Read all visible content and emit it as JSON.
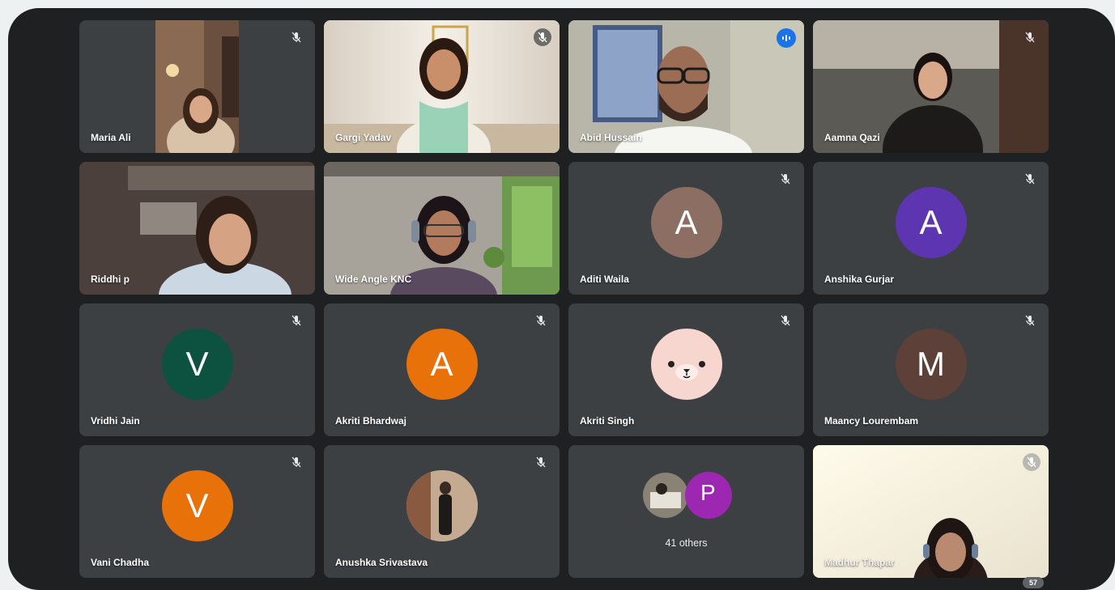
{
  "meeting": {
    "participants_count": "57",
    "others_label": "41 others",
    "tiles": [
      {
        "name": "Maria Ali"
      },
      {
        "name": "Gargi Yadav"
      },
      {
        "name": "Abid Hussain"
      },
      {
        "name": "Aamna Qazi"
      },
      {
        "name": "Riddhi p"
      },
      {
        "name": "Wide Angle KNC"
      },
      {
        "name": "Aditi Waila",
        "initial": "A"
      },
      {
        "name": "Anshika Gurjar",
        "initial": "A"
      },
      {
        "name": "Vridhi Jain",
        "initial": "V"
      },
      {
        "name": "Akriti Bhardwaj",
        "initial": "A"
      },
      {
        "name": "Akriti Singh"
      },
      {
        "name": "Maancy Lourembam",
        "initial": "M"
      },
      {
        "name": "Vani Chadha",
        "initial": "V"
      },
      {
        "name": "Anushka Srivastava"
      },
      {
        "name": ""
      },
      {
        "name": "Madhur Thapar"
      }
    ],
    "others_avatar_initial": "P"
  },
  "colors": {
    "tile_bg": "#3c4043",
    "speaking_border": "#8ab4f8",
    "avatar_brown": "#8d6e63",
    "avatar_purple": "#5e35b1",
    "avatar_green": "#0d5240",
    "avatar_orange": "#e8710a",
    "avatar_dark_brown": "#5d4037",
    "avatar_pink": "#f7d6d0",
    "avatar_magenta": "#9c27b0"
  }
}
